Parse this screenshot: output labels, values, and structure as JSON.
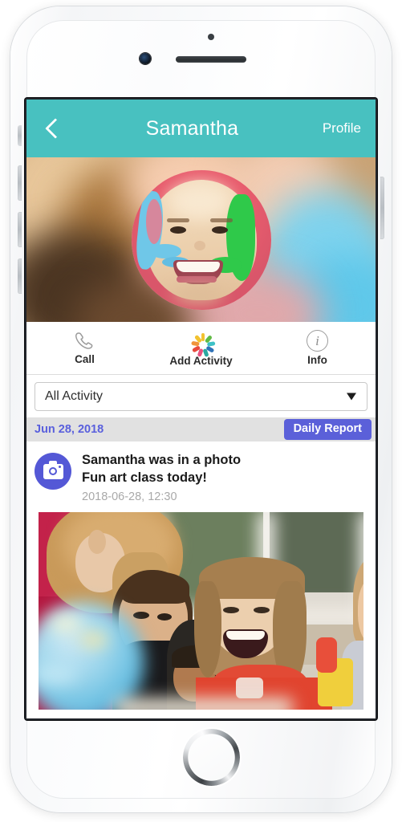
{
  "device": {
    "name": "white-iphone",
    "elements": [
      "front-camera",
      "earpiece-speaker",
      "proximity-sensor",
      "home-button",
      "volume-buttons",
      "power-button"
    ]
  },
  "appbar": {
    "back_icon": "chevron-left-icon",
    "title": "Samantha",
    "action_label": "Profile",
    "background_color": "#48c1c0",
    "text_color": "#ffffff"
  },
  "hero": {
    "description": "Blurred classroom background with circular child portrait",
    "avatar_alt": "Smiling girl with blue and green face paint"
  },
  "actions": [
    {
      "label": "Call",
      "icon": "phone-icon"
    },
    {
      "label": "Add Activity",
      "icon": "pinwheel-icon"
    },
    {
      "label": "Info",
      "icon": "info-icon"
    }
  ],
  "pinwheel_colors": [
    "#f2c230",
    "#62bb46",
    "#3ec1c6",
    "#2f72b8",
    "#3b7fa8",
    "#2aa8a0",
    "#e8507e",
    "#e8493c",
    "#f0943a"
  ],
  "filter": {
    "selected": "All Activity",
    "caret_icon": "chevron-down-icon",
    "options": [
      "All Activity"
    ]
  },
  "date_section": {
    "date_label": "Jun 28, 2018",
    "report_button": "Daily Report",
    "bar_color": "#e1e1e1",
    "date_text_color": "#5a60dd",
    "button_color": "#5b60d9"
  },
  "feed_item": {
    "icon": "camera-icon",
    "icon_color": "#5458d6",
    "title": "Samantha was in a photo",
    "subtitle": "Fun art class today!",
    "timestamp": "2018-06-28, 12:30",
    "photo_alt": "Children gathered around a globe in a classroom"
  }
}
